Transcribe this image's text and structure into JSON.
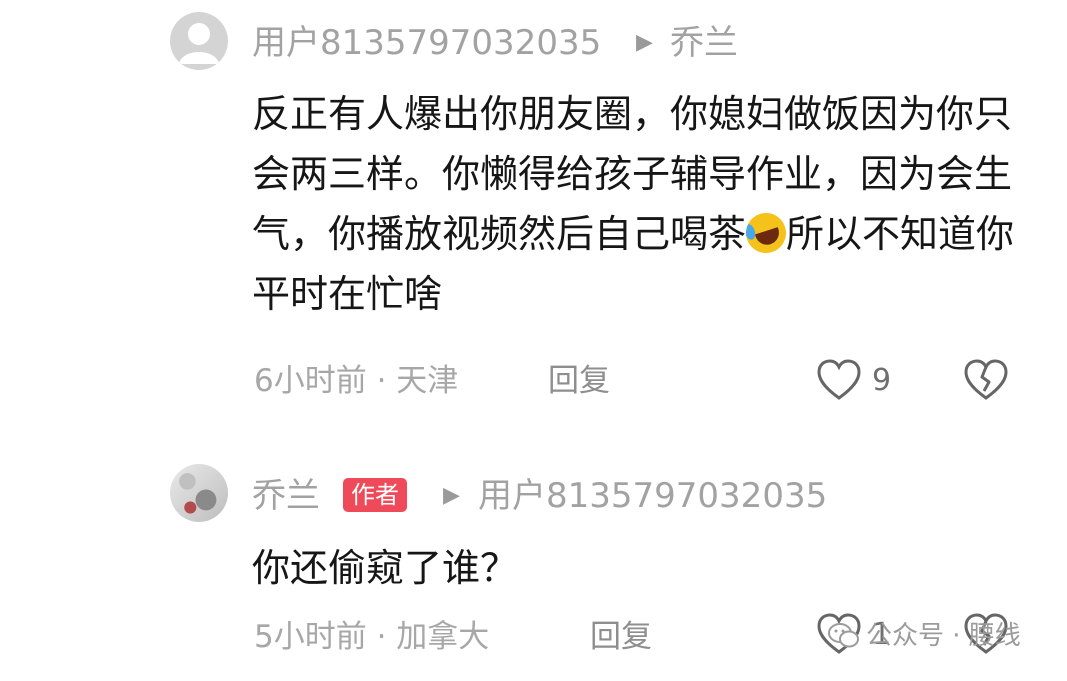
{
  "comments": [
    {
      "username": "用户8135797032035",
      "reply_to": "乔兰",
      "text_before_emoji": "反正有人爆出你朋友圈，你媳妇做饭因为你只会两三样。你懒得给孩子辅导作业，因为会生气，你播放视频然后自己喝茶",
      "text_after_emoji": "所以不知道你平时在忙啥",
      "time_location": "6小时前 · 天津",
      "reply_label": "回复",
      "likes": "9"
    },
    {
      "username": "乔兰",
      "badge": "作者",
      "reply_to": "用户8135797032035",
      "text": "你还偷窥了谁？",
      "time_location": "5小时前 · 加拿大",
      "reply_label": "回复",
      "likes": "1"
    }
  ],
  "watermark": "公众号 · 腰线",
  "icons": {
    "reply_arrow": "triangle-right-icon",
    "like": "heart-outline-icon",
    "dislike": "broken-heart-icon",
    "emoji": "rolling-laughing-emoji-icon",
    "watermark": "wechat-icon"
  }
}
